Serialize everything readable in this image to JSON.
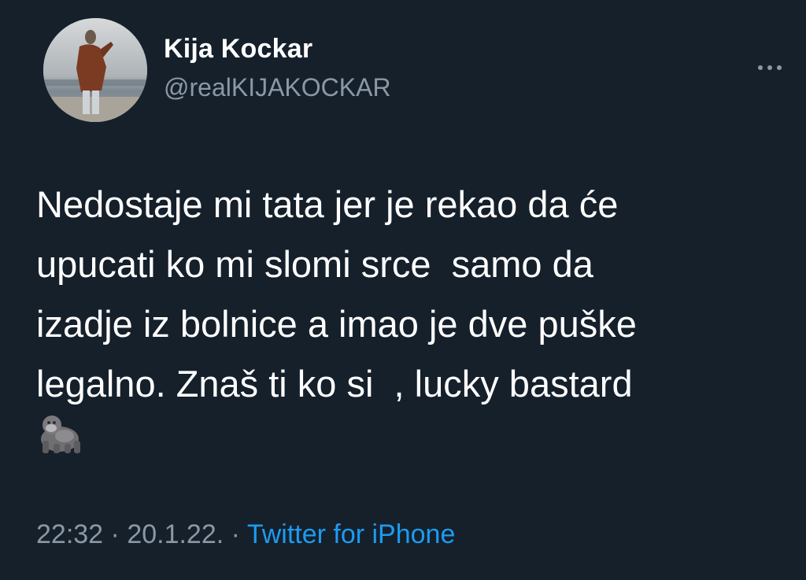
{
  "author": {
    "display_name": "Kija Kockar",
    "handle": "@realKIJAKOCKAR"
  },
  "tweet": {
    "lines": [
      "Nedostaje mi tata jer je rekao da će",
      "upucati ko mi slomi srce  samo da",
      "izadje iz bolnice a imao je dve puške",
      "legalno. Znaš ti ko si  , lucky bastard"
    ],
    "emoji": "gorilla-emoji"
  },
  "meta": {
    "time": "22:32",
    "separator1": " · ",
    "date": "20.1.22.",
    "separator2": " · ",
    "source": "Twitter for iPhone"
  },
  "icons": {
    "more": "more-horizontal-icon"
  },
  "colors": {
    "background": "#15202b",
    "text": "#ffffff",
    "secondary": "#8b98a5",
    "link": "#1d9bf0"
  }
}
